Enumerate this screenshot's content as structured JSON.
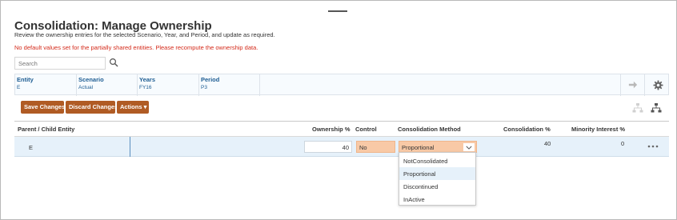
{
  "page": {
    "title": "Consolidation: Manage Ownership",
    "subtitle": "Review the ownership entries for the selected Scenario, Year, and Period, and update as required.",
    "warning": "No default values set for the partially shared entities. Please recompute the ownership data."
  },
  "search": {
    "placeholder": "Search"
  },
  "pov": [
    {
      "label": "Entity",
      "value": "E"
    },
    {
      "label": "Scenario",
      "value": "Actual"
    },
    {
      "label": "Years",
      "value": "FY16"
    },
    {
      "label": "Period",
      "value": "P3"
    }
  ],
  "toolbar": {
    "save_label": "Save Changes",
    "discard_label": "Discard Changes",
    "actions_label": "Actions ▾"
  },
  "grid": {
    "headers": {
      "entity": "Parent / Child Entity",
      "ownership": "Ownership %",
      "control": "Control",
      "method": "Consolidation Method",
      "consolidation": "Consolidation %",
      "minority": "Minority Interest %"
    },
    "row": {
      "entity": "E",
      "ownership": "40",
      "control": "No",
      "method": "Proportional",
      "consolidation": "40",
      "minority": "0"
    }
  },
  "method_options": [
    "NotConsolidated",
    "Proportional",
    "Discontinued",
    "InActive"
  ],
  "method_selected": "Proportional",
  "colors": {
    "accent": "#b05b24",
    "link": "#1e5d93",
    "warning": "#d42a1a",
    "highlight": "#f8c9a6",
    "row_selected": "#e6f1fa"
  },
  "icons": {
    "search": "search-icon",
    "go": "arrow-right-icon",
    "settings": "gear-icon",
    "hierarchy_disabled": "hierarchy-icon",
    "hierarchy": "hierarchy-icon",
    "dropdown": "chevron-down-icon",
    "more": "more-icon"
  }
}
